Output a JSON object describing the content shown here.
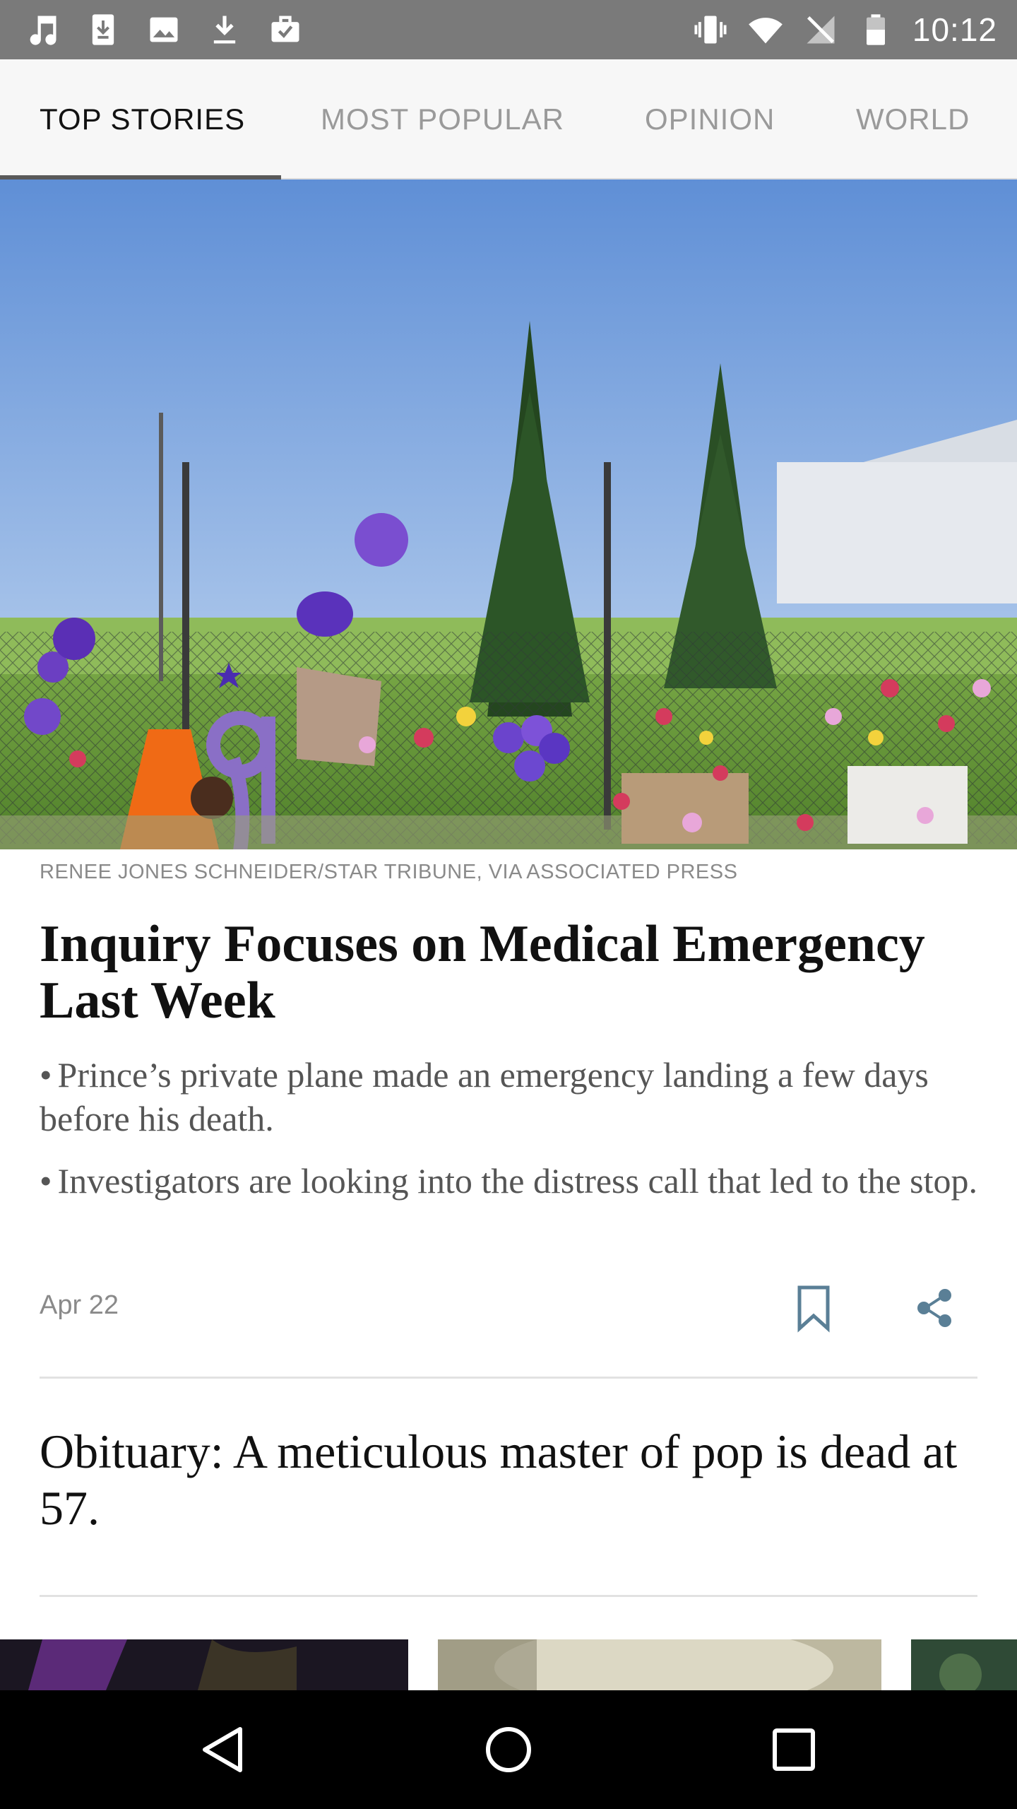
{
  "status_bar": {
    "time": "10:12",
    "left_icons": [
      "music-icon",
      "download-box-icon",
      "image-icon",
      "download-icon",
      "briefcase-check-icon"
    ],
    "right_icons": [
      "vibrate-icon",
      "wifi-icon",
      "no-signal-icon",
      "battery-icon"
    ]
  },
  "tabs": [
    {
      "label": "TOP STORIES",
      "active": true
    },
    {
      "label": "MOST POPULAR",
      "active": false
    },
    {
      "label": "OPINION",
      "active": false
    },
    {
      "label": "WORLD",
      "active": false
    }
  ],
  "lead_story": {
    "photo_credit": "RENEE JONES SCHNEIDER/STAR TRIBUNE, VIA ASSOCIATED PRESS",
    "headline": "Inquiry Focuses on Medical Emergency Last Week",
    "bullets": [
      "Prince’s private plane made an emergency landing a few days before his death.",
      "Investigators are looking into the distress call that led to the stop."
    ],
    "date": "Apr 22",
    "actions": [
      "bookmark-icon",
      "share-icon"
    ]
  },
  "second_story": {
    "headline": "Obituary: A meticulous master of pop is dead at 57."
  },
  "nav_bar": {
    "buttons": [
      "back-icon",
      "home-icon",
      "recents-icon"
    ]
  },
  "colors": {
    "status_bar": "#7a7a7a",
    "tab_bar": "#f7f7f7",
    "active_tab_text": "#121212",
    "inactive_tab_text": "#9a9a9a",
    "tab_indicator": "#5a5a5a",
    "share_icon": "#5a7f96",
    "bookmark_icon": "#5a7f96",
    "nav_bar": "#000000"
  }
}
